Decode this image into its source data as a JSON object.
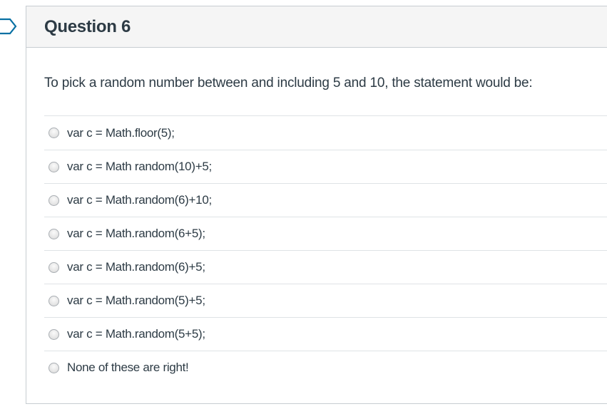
{
  "question": {
    "title": "Question 6",
    "text": "To pick a random number between and including 5 and 10, the statement would be:",
    "answers": [
      {
        "label": "var c = Math.floor(5);"
      },
      {
        "label": "var c = Math random(10)+5;"
      },
      {
        "label": "var c = Math.random(6)+10;"
      },
      {
        "label": "var c = Math.random(6+5);"
      },
      {
        "label": "var c = Math.random(6)+5;"
      },
      {
        "label": "var c = Math.random(5)+5;"
      },
      {
        "label": "var c = Math.random(5+5);"
      },
      {
        "label": "None of these are right!"
      }
    ]
  },
  "colors": {
    "text": "#2d3b45",
    "border": "#c7cdd1",
    "header_bg": "#f5f5f5",
    "flag_stroke": "#0770a3"
  },
  "icons": {
    "flag": "flag-question-icon"
  }
}
